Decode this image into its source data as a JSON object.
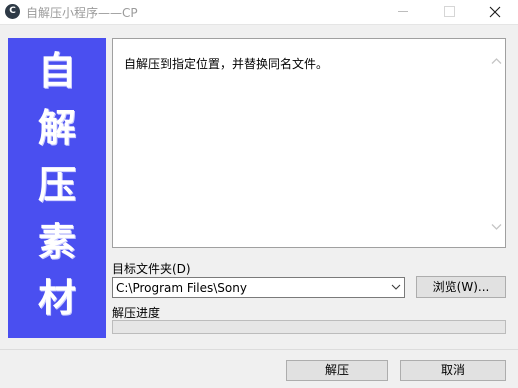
{
  "window": {
    "title": "自解压小程序——CP",
    "app_icon": "sfx-logo-icon",
    "app_icon_glyph": "C"
  },
  "banner": {
    "chars": [
      "自",
      "解",
      "压",
      "素",
      "材"
    ],
    "color": "#4a4ff0"
  },
  "message": {
    "text": "自解压到指定位置，并替换同名文件。"
  },
  "folder": {
    "label": "目标文件夹(D)",
    "path": "C:\\Program Files\\Sony",
    "browse_label": "浏览(W)..."
  },
  "progress": {
    "label": "解压进度",
    "value": 0
  },
  "buttons": {
    "extract_label": "解压",
    "cancel_label": "取消"
  },
  "icons": {
    "minimize": "minimize-icon",
    "maximize": "maximize-icon",
    "close": "close-icon",
    "scroll_up": "chevron-up-icon",
    "scroll_down": "chevron-down-icon",
    "dropdown": "chevron-down-icon"
  }
}
